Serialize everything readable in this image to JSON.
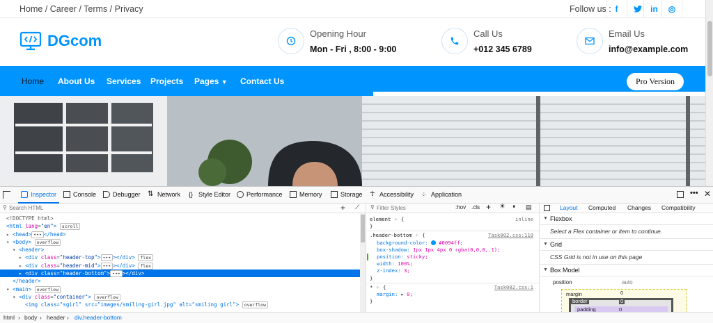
{
  "site": {
    "breadcrumbs": "Home / Career / Terms / Privacy",
    "follow_label": "Follow us :",
    "social": [
      {
        "icon": "facebook-icon",
        "glyph": "f"
      },
      {
        "icon": "twitter-icon",
        "glyph": "t"
      },
      {
        "icon": "linkedin-icon",
        "glyph": "in"
      },
      {
        "icon": "instagram-icon",
        "glyph": "◎"
      }
    ],
    "brand_name": "DGcom",
    "info": [
      {
        "icon": "clock-icon",
        "label": "Opening Hour",
        "value": "Mon - Fri , 8:00 - 9:00"
      },
      {
        "icon": "phone-icon",
        "label": "Call Us",
        "value": "+012 345 6789"
      },
      {
        "icon": "mail-icon",
        "label": "Email Us",
        "value": "info@example.com"
      }
    ],
    "nav": [
      "Home",
      "About Us",
      "Services",
      "Projects",
      "Pages",
      "Contact Us"
    ],
    "pro_button": "Pro Version",
    "accent_color": "#0094ff"
  },
  "devtools": {
    "tabs": [
      "Inspector",
      "Console",
      "Debugger",
      "Network",
      "Style Editor",
      "Performance",
      "Memory",
      "Storage",
      "Accessibility",
      "Application"
    ],
    "search_placeholder": "Search HTML",
    "filter_placeholder": "Filter Styles",
    "pseudo_label": ":hov",
    "cls_label": ".cls",
    "layout_tabs": [
      "Layout",
      "Computed",
      "Changes",
      "Compatibility"
    ],
    "html_tree": {
      "l1": "<!DOCTYPE html>",
      "l2_tag": "<html",
      "l2_attr": "lang",
      "l2_val": "\"en\"",
      "l2_badge": "scroll",
      "l3": "<head>",
      "l3_end": "</head>",
      "l4_tag": "<body>",
      "l4_badge": "overflow",
      "l5": "<header>",
      "l6_val": "\"header-top\"",
      "l6_badge": "flex",
      "l7_val": "\"header-mid\"",
      "l7_badge": "flex",
      "l8_val": "\"header-bottom\"",
      "l9": "</header>",
      "l10_tag": "<main>",
      "l10_badge": "overflow",
      "l11_val": "\"container\"",
      "l11_badge": "overflow",
      "l12": "<img class=\"sgirl\" src=\"images/smiling-girl.jpg\" alt=\"smiling girl\">",
      "l12_badge": "overflow",
      "div_open": "<div",
      "div_close": "></div>",
      "class_attr": "class",
      "ellipsis": "•••"
    },
    "rules": {
      "element_sel": "element",
      "element_src": "inline",
      "open": "{",
      "close": "}",
      "hb_sel": ".header-bottom",
      "hb_src": "Task002.css:110",
      "hb_props": [
        {
          "p": "background-color:",
          "v": "#0094ff;"
        },
        {
          "p": "box-shadow:",
          "v": "1px 1px 4px 0 rgba(0,0,0,.1);"
        },
        {
          "p": "position:",
          "v": "sticky;"
        },
        {
          "p": "width:",
          "v": "100%;"
        },
        {
          "p": "z-index:",
          "v": "3;"
        }
      ],
      "star_sel": "*",
      "star_src": "Task002.css:1",
      "star_prop": "margin:",
      "star_val": "0;"
    },
    "layout": {
      "flexbox_title": "Flexbox",
      "flexbox_msg": "Select a Flex container or item to continue.",
      "grid_title": "Grid",
      "grid_msg": "CSS Grid is not in use on this page",
      "boxmodel_title": "Box Model",
      "position_label": "position",
      "position_value": "auto",
      "margin_label": "margin",
      "margin_value": "0",
      "border_label": "border",
      "border_value": "0",
      "padding_label": "padding",
      "padding_value": "0"
    },
    "breadcrumb": [
      "html",
      "body",
      "header",
      "div.header-bottom"
    ]
  }
}
